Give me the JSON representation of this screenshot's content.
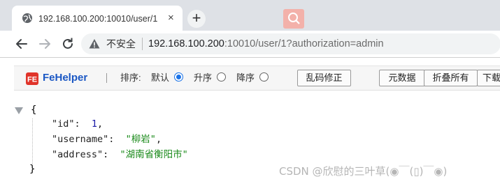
{
  "tab": {
    "title": "192.168.100.200:10010/user/1",
    "close_glyph": "×",
    "icon": "globe-icon"
  },
  "new_tab": {
    "glyph": "+"
  },
  "address_bar": {
    "security_label": "不安全",
    "url_host": "192.168.100.200",
    "url_rest": ":10010/user/1?authorization=admin"
  },
  "fehelper": {
    "brand": "FeHelper",
    "sort_label": "排序:",
    "sort_options": [
      {
        "label": "默认",
        "selected": true
      },
      {
        "label": "升序",
        "selected": false
      },
      {
        "label": "降序",
        "selected": false
      }
    ],
    "buttons": {
      "fix_encoding": "乱码修正",
      "metadata": "元数据",
      "collapse_all": "折叠所有",
      "download": "下载"
    }
  },
  "json_view": {
    "open_brace": "{",
    "close_brace": "}",
    "entries": [
      {
        "key": "\"id\"",
        "value": "1",
        "type": "number",
        "comma": ","
      },
      {
        "key": "\"username\"",
        "value": "\"柳岩\"",
        "type": "string",
        "comma": ","
      },
      {
        "key": "\"address\"",
        "value": "\"湖南省衡阳市\"",
        "type": "string",
        "comma": ""
      }
    ]
  },
  "watermark": "CSDN @欣慰的三叶草(◉￣(▯)￣◉)",
  "colors": {
    "tab_strip": "#dee1e6",
    "fehelper_brand": "#1a57c4",
    "number": "#1a1aa6",
    "string": "#1a8a1a"
  }
}
